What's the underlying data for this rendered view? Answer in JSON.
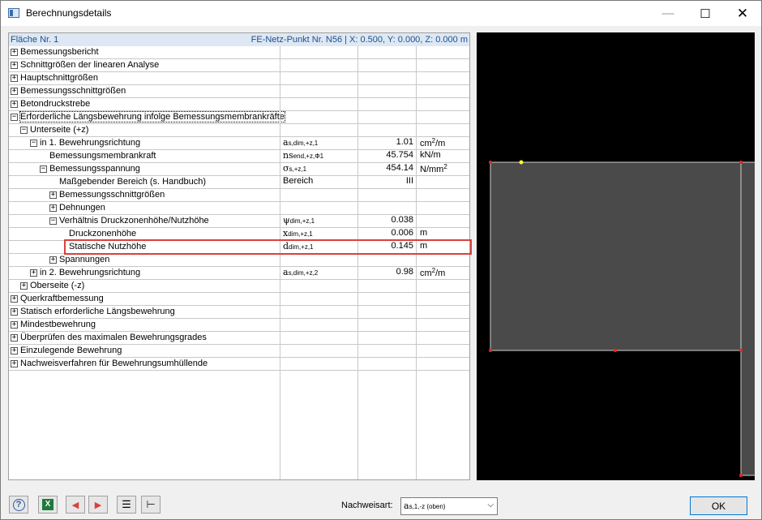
{
  "window": {
    "title": "Berechnungsdetails",
    "minimize_glyph": "—",
    "maximize_glyph": "☐",
    "close_glyph": "✕"
  },
  "tree": {
    "header_left": "Fläche Nr. 1",
    "header_right": "FE-Netz-Punkt Nr. N56  |  X: 0.500, Y: 0.000, Z: 0.000 m",
    "rows": [
      {
        "label": "Bemessungsbericht",
        "expander": "+"
      },
      {
        "label": "Schnittgrößen der linearen Analyse",
        "expander": "+"
      },
      {
        "label": "Hauptschnittgrößen",
        "expander": "+"
      },
      {
        "label": "Bemessungsschnittgrößen",
        "expander": "+"
      },
      {
        "label": "Betondruckstrebe",
        "expander": "+"
      },
      {
        "label": "Erforderliche Längsbewehrung infolge Bemessungsmembrankräfte",
        "expander": "−"
      },
      {
        "label": "Unterseite (+z)",
        "expander": "−"
      },
      {
        "label": "in 1. Bewehrungsrichtung",
        "expander": "−",
        "sym": "a",
        "sub": "s,dim,+z,1",
        "value": "1.01",
        "unit": "cm",
        "unit_sup": "2",
        "unit_tail": "/m"
      },
      {
        "label": "Bemessungsmembrankraft",
        "sym": "ns",
        "sub": "end,+z,Φ1",
        "value": "45.754",
        "unit": "kN/m"
      },
      {
        "label": "Bemessungsspannung",
        "expander": "−",
        "sym": "σ",
        "sub": "s,+z,1",
        "value": "454.14",
        "unit": "N/mm",
        "unit_sup": "2"
      },
      {
        "label": "Maßgebender Bereich (s. Handbuch)",
        "sym_text": "Bereich",
        "value": "III"
      },
      {
        "label": "Bemessungsschnittgrößen",
        "expander": "+"
      },
      {
        "label": "Dehnungen",
        "expander": "+"
      },
      {
        "label": "Verhältnis Druckzonenhöhe/Nutzhöhe",
        "expander": "−",
        "sym": "ψ",
        "sub": "dim,+z,1",
        "value": "0.038"
      },
      {
        "label": "Druckzonenhöhe",
        "sym": "x",
        "sub": "dim,+z,1",
        "value": "0.006",
        "unit": "m"
      },
      {
        "label": "Statische Nutzhöhe",
        "sym": "d",
        "sub": "dim,+z,1",
        "value": "0.145",
        "unit": "m"
      },
      {
        "label": "Spannungen",
        "expander": "+"
      },
      {
        "label": "in 2. Bewehrungsrichtung",
        "expander": "+",
        "sym": "a",
        "sub": "s,dim,+z,2",
        "value": "0.98",
        "unit": "cm",
        "unit_sup": "2",
        "unit_tail": "/m"
      },
      {
        "label": "Oberseite (-z)",
        "expander": "+"
      },
      {
        "label": "Querkraftbemessung",
        "expander": "+"
      },
      {
        "label": "Statisch erforderliche Längsbewehrung",
        "expander": "+"
      },
      {
        "label": "Mindestbewehrung",
        "expander": "+"
      },
      {
        "label": "Überprüfen des maximalen Bewehrungsgrades",
        "expander": "+"
      },
      {
        "label": "Einzulegende Bewehrung",
        "expander": "+"
      },
      {
        "label": "Nachweisverfahren für Bewehrungsumhüllende",
        "expander": "+"
      }
    ]
  },
  "view": {
    "colors": {
      "background": "#000000",
      "surface": "#4a4a4a",
      "edge": "#d0d0d0",
      "node": "#ff2020",
      "selected_node": "#ffff30"
    }
  },
  "bottom": {
    "help_icon": "?",
    "excel_icon": "X",
    "prev_icon": "◀",
    "next_icon": "▶",
    "list_icon": "☰",
    "tree_icon": "⊢",
    "nachweisart_label": "Nachweisart:",
    "nachweisart_sym": "a",
    "nachweisart_sub": "s,1,-z (oben)",
    "ok_label": "OK"
  }
}
